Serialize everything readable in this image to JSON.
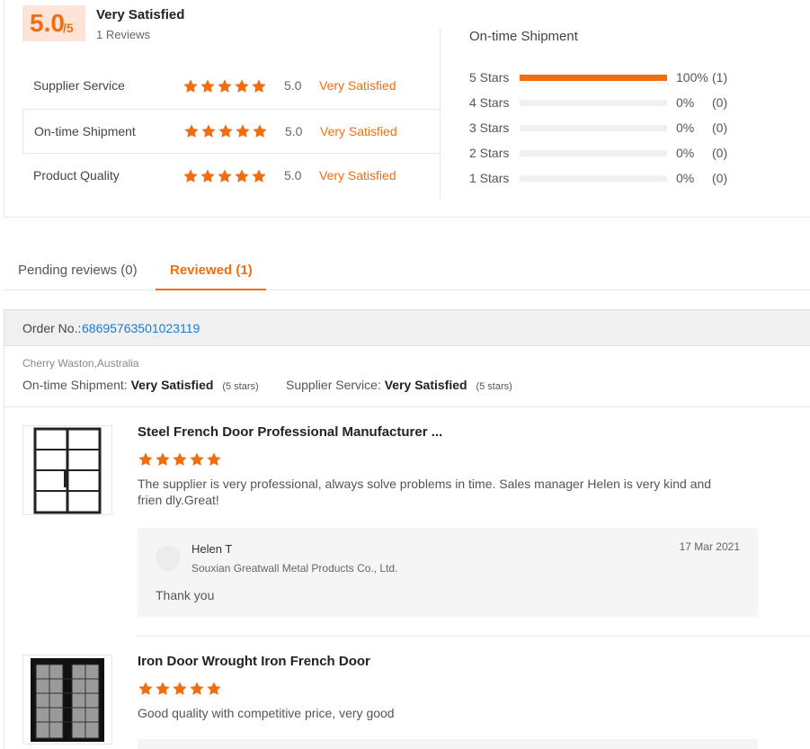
{
  "summary": {
    "score_main": "5.0",
    "score_sub": "/5",
    "overall_label": "Very Satisfied",
    "reviews_count": "1 Reviews",
    "rating_rows": [
      {
        "name": "Supplier Service",
        "score": "5.0",
        "text": "Very Satisfied",
        "stars": 5
      },
      {
        "name": "On-time Shipment",
        "score": "5.0",
        "text": "Very Satisfied",
        "stars": 5
      },
      {
        "name": "Product Quality",
        "score": "5.0",
        "text": "Very Satisfied",
        "stars": 5
      }
    ],
    "distribution_title": "On-time Shipment",
    "distribution": [
      {
        "label": "5  Stars",
        "percent": "100%",
        "count": "(1)",
        "fill": 1.0
      },
      {
        "label": "4  Stars",
        "percent": "0%",
        "count": "(0)",
        "fill": 0
      },
      {
        "label": "3  Stars",
        "percent": "0%",
        "count": "(0)",
        "fill": 0
      },
      {
        "label": "2  Stars",
        "percent": "0%",
        "count": "(0)",
        "fill": 0
      },
      {
        "label": "1  Stars",
        "percent": "0%",
        "count": "(0)",
        "fill": 0
      }
    ]
  },
  "tabs": {
    "pending": "Pending reviews (0)",
    "reviewed": "Reviewed (1)"
  },
  "order": {
    "label": "Order No.:",
    "number": "68695763501023119",
    "buyer": "Cherry Waston,Australia",
    "shipment_label": "On-time Shipment:",
    "shipment_value": "Very Satisfied",
    "shipment_stars": "(5 stars)",
    "service_label": "Supplier Service:",
    "service_value": "Very Satisfied",
    "service_stars": "(5 stars)"
  },
  "products": [
    {
      "title": "Steel French Door Professional Manufacturer ...",
      "stars": 5,
      "comment": "The supplier is very professional, always solve problems in time. Sales manager Helen is very kind and frien dly.Great!",
      "reply": {
        "name": "Helen T",
        "company": "Souxian Greatwall Metal Products Co., Ltd.",
        "date": "17 Mar 2021",
        "text": "Thank you"
      }
    },
    {
      "title": "Iron Door Wrought Iron French Door",
      "stars": 5,
      "comment": "Good quality with competitive price, very good"
    }
  ],
  "colors": {
    "accent": "#f06e12",
    "link": "#1a7bd0"
  }
}
